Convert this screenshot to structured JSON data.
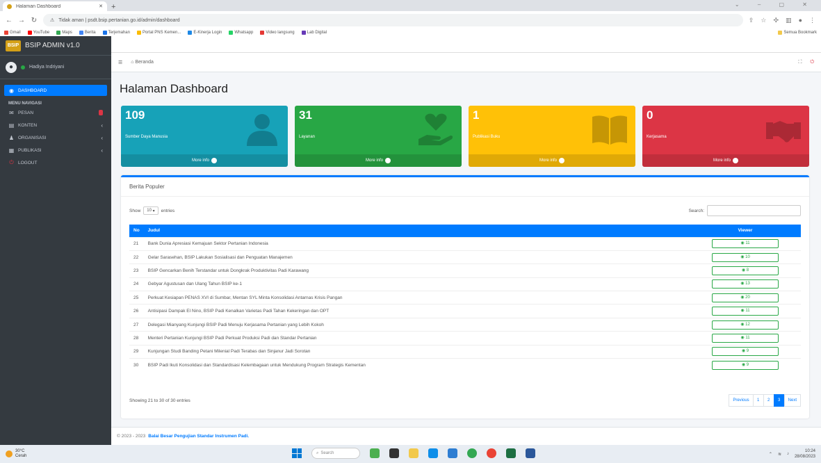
{
  "browser": {
    "tab_title": "Halaman Dashboard",
    "url": "Tidak aman | psdt.bsip.pertanian.go.id/admin/dashboard",
    "bookmarks": [
      "Gmail",
      "YouTube",
      "Maps",
      "Berita",
      "Terjemahan",
      "Portal PNS Kemen...",
      "E-Kinerja Login",
      "Whatsapp",
      "Video langsung",
      "Lab Digital"
    ],
    "bookmarks_right": "Semua Bookmark"
  },
  "sidebar": {
    "brand": "BSIP ADMIN v1.0",
    "brand_logo": "BSIP",
    "user": "Hadiya Indriyani",
    "items": [
      {
        "label": "DASHBOARD",
        "icon": "dashboard-icon",
        "active": true
      },
      {
        "label": "PESAN",
        "icon": "mail-icon",
        "badge": true
      },
      {
        "label": "KONTEN",
        "icon": "content-icon",
        "chevron": true
      },
      {
        "label": "ORGANISASI",
        "icon": "organization-icon",
        "chevron": true
      },
      {
        "label": "PUBLIKASI",
        "icon": "book-icon",
        "chevron": true
      },
      {
        "label": "LOGOUT",
        "icon": "power-icon"
      }
    ],
    "menu_header": "MENU NAVIGASI"
  },
  "topnav": {
    "home_label": "Beranda"
  },
  "page": {
    "title": "Halaman Dashboard"
  },
  "boxes": [
    {
      "value": "109",
      "label": "Sumber Daya Manusia",
      "more": "More info",
      "color": "#17a2b8",
      "icon": "user-icon"
    },
    {
      "value": "31",
      "label": "Layanan",
      "more": "More info",
      "color": "#28a745",
      "icon": "hand-heart-icon"
    },
    {
      "value": "1",
      "label": "Publikasi Buku",
      "more": "More info",
      "color": "#ffc107",
      "icon": "book-icon"
    },
    {
      "value": "0",
      "label": "Kerjasama",
      "more": "More info",
      "color": "#dc3545",
      "icon": "handshake-icon"
    }
  ],
  "card": {
    "title": "Berita Populer",
    "show_label": "Show",
    "entries_value": "10",
    "entries_label": "entries",
    "search_label": "Search:",
    "columns": {
      "no": "No",
      "judul": "Judul",
      "viewer": "Viewer"
    },
    "rows": [
      {
        "no": "21",
        "judul": "Bank Dunia Apresiasi Kemajuan Sektor Pertanian Indonesia",
        "viewer": "11"
      },
      {
        "no": "22",
        "judul": "Gelar Sarasehan, BSIP Lakukan Sosialisasi dan Penguatan Manajemen",
        "viewer": "10"
      },
      {
        "no": "23",
        "judul": "BSIP Gencarkan Benih Terstandar untuk Dongkrak Produktivitas Padi Karawang",
        "viewer": "8"
      },
      {
        "no": "24",
        "judul": "Gebyar Agustusan dan Ulang Tahun BSIP ke-1",
        "viewer": "13"
      },
      {
        "no": "25",
        "judul": "Perkuat Kesiapan PENAS XVI di Sumbar, Mentan SYL Minta Konsolidasi Antarnas Krisis Pangan",
        "viewer": "20"
      },
      {
        "no": "26",
        "judul": "Antisipasi Dampak El Nino, BSIP Padi Kenalkan Varietas Padi Tahan Kekeringan dan OPT",
        "viewer": "11"
      },
      {
        "no": "27",
        "judul": "Delegasi Mianyang Kunjungi BSIP Padi Menuju Kerjasama Pertanian yang Lebih Kokoh",
        "viewer": "12"
      },
      {
        "no": "28",
        "judul": "Menteri Pertanian Kunjungi BSIP Padi Perkuat Produksi Padi dan Standar Pertanian",
        "viewer": "11"
      },
      {
        "no": "29",
        "judul": "Kunjungan Studi Banding Petani Milenial Padi Terabas dan Sinjanur Jadi Sorotan",
        "viewer": "9"
      },
      {
        "no": "30",
        "judul": "BSIP Padi Ikuti Konsolidasi dan Standardisasi Kelembagaan untuk Mendukung Program Strategis Kementan",
        "viewer": "9"
      }
    ],
    "info": "Showing 21 to 30 of 30 entries",
    "pager": [
      {
        "label": "Previous",
        "active": false
      },
      {
        "label": "1",
        "active": false
      },
      {
        "label": "2",
        "active": false
      },
      {
        "label": "3",
        "active": true
      },
      {
        "label": "Next",
        "active": false
      }
    ]
  },
  "footer": {
    "prefix": "© 2023 - 2023",
    "org": "Balai Besar Pengujian Standar Instrumen Padi."
  },
  "taskbar": {
    "weather": "30°C",
    "weather_sub": "Cerah",
    "search": "Search",
    "time": "10:24",
    "date": "28/08/2023"
  }
}
